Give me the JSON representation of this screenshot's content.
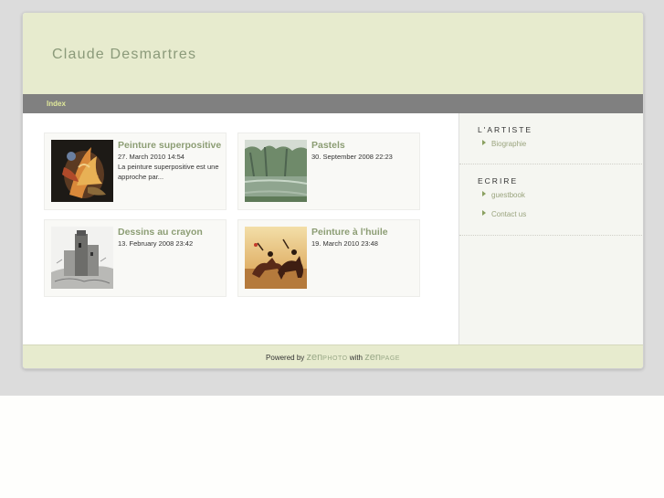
{
  "site": {
    "title": "Claude Desmartres"
  },
  "nav": {
    "items": [
      {
        "label": "Index"
      }
    ]
  },
  "albums": [
    {
      "title": "Peinture superpositive",
      "date": "27. March 2010 14:54",
      "description": "La peinture superpositive est une approche par..."
    },
    {
      "title": "Pastels",
      "date": "30. September 2008 22:23",
      "description": ""
    },
    {
      "title": "Dessins au crayon",
      "date": "13. February 2008 23:42",
      "description": ""
    },
    {
      "title": "Peinture à l'huile",
      "date": "19. March 2010 23:48",
      "description": ""
    }
  ],
  "sidebar": {
    "artiste": {
      "heading": "L'ARTISTE",
      "links": [
        {
          "label": "Biographie"
        }
      ]
    },
    "ecrire": {
      "heading": "ECRIRE",
      "links": [
        {
          "label": "guestbook"
        },
        {
          "label": "Contact us"
        }
      ]
    }
  },
  "footer": {
    "powered_by": "Powered by",
    "zen1": "zen",
    "photo": "PHOTO",
    "with": "with",
    "zen2": "zen",
    "page": "PAGE"
  },
  "colors": {
    "accent": "#8c9d74",
    "header_bg": "#e7ebce",
    "nav_bg": "#808080"
  },
  "icons": {
    "sidebar_bullet": "bullet-icon"
  }
}
